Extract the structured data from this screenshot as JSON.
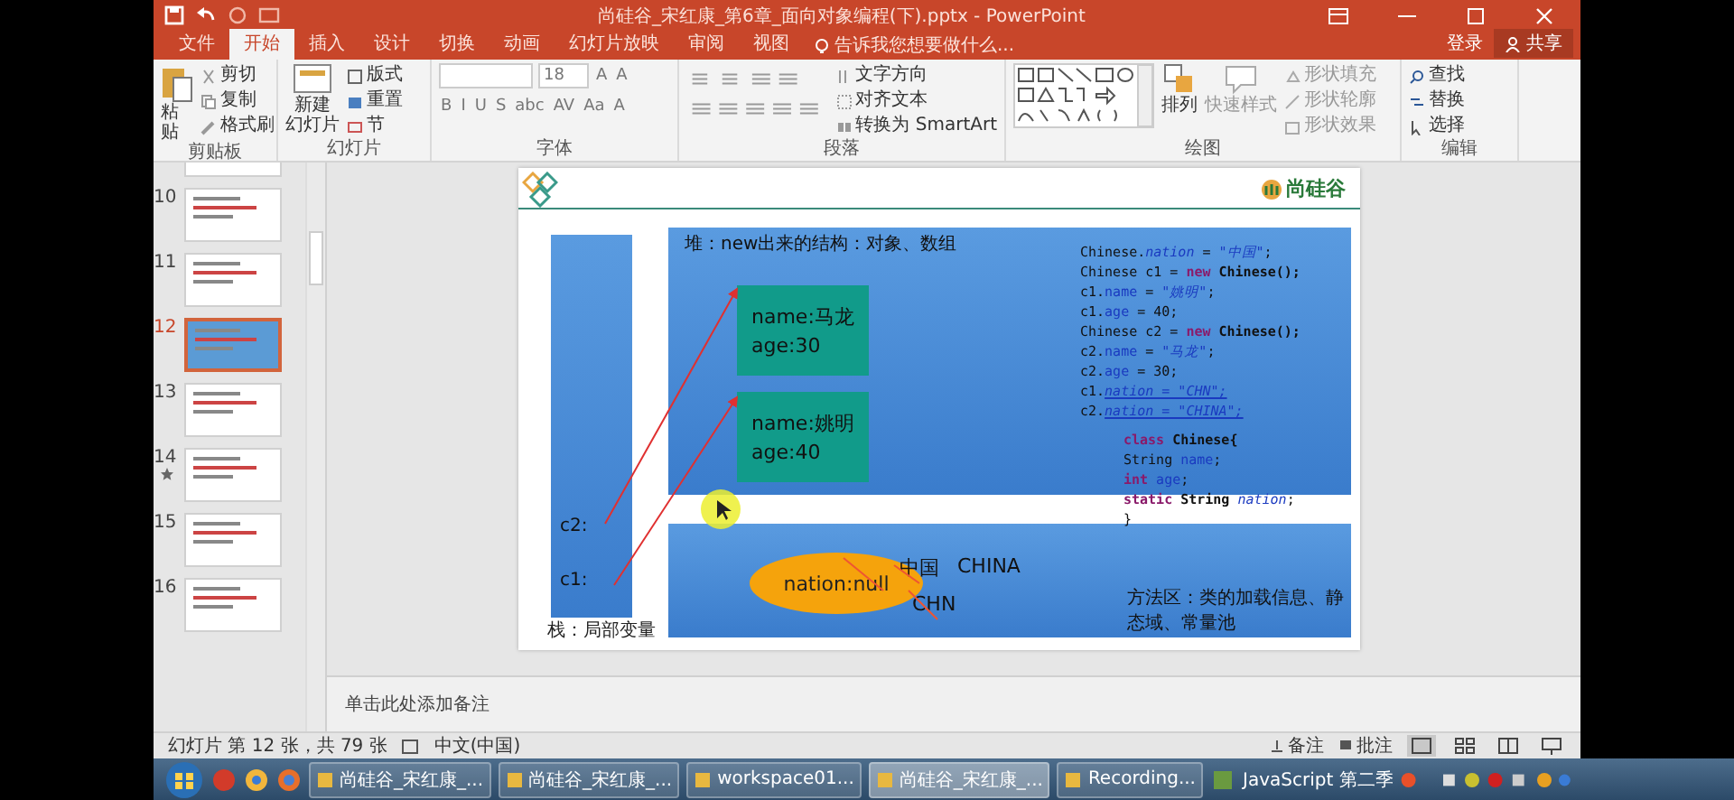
{
  "window": {
    "title": "尚硅谷_宋红康_第6章_面向对象编程(下).pptx - PowerPoint"
  },
  "tabs": [
    {
      "label": "文件",
      "selected": false
    },
    {
      "label": "开始",
      "selected": true
    },
    {
      "label": "插入",
      "selected": false
    },
    {
      "label": "设计",
      "selected": false
    },
    {
      "label": "切换",
      "selected": false
    },
    {
      "label": "动画",
      "selected": false
    },
    {
      "label": "幻灯片放映",
      "selected": false
    },
    {
      "label": "审阅",
      "selected": false
    },
    {
      "label": "视图",
      "selected": false
    }
  ],
  "tell_me": {
    "placeholder": "告诉我您想要做什么..."
  },
  "account": {
    "sign_in": "登录",
    "share": "共享"
  },
  "ribbon": {
    "clipboard": {
      "label": "剪贴板",
      "paste": "粘贴",
      "cut": "剪切",
      "copy": "复制",
      "painter": "格式刷"
    },
    "slides": {
      "label": "幻灯片",
      "new_slide": "新建",
      "new_slide_2": "幻灯片",
      "layout": "版式",
      "reset": "重置",
      "section": "节"
    },
    "font": {
      "label": "字体",
      "size": "18",
      "top_buttons": [
        "A",
        "A"
      ],
      "buttons": [
        "B",
        "I",
        "U",
        "S",
        "abc",
        "AV",
        "Aa",
        "A"
      ]
    },
    "paragraph": {
      "label": "段落",
      "direction": "文字方向",
      "align": "对齐文本",
      "smartart": "转换为 SmartArt"
    },
    "drawing": {
      "label": "绘图",
      "arrange": "排列",
      "quick_styles": "快速样式",
      "fill": "形状填充",
      "outline": "形状轮廓",
      "effects": "形状效果"
    },
    "editing": {
      "label": "编辑",
      "find": "查找",
      "replace": "替换",
      "select": "选择"
    }
  },
  "thumbnails": [
    {
      "number": "10",
      "selected": false,
      "starred": false
    },
    {
      "number": "11",
      "selected": false,
      "starred": false
    },
    {
      "number": "12",
      "selected": true,
      "starred": false
    },
    {
      "number": "13",
      "selected": false,
      "starred": false
    },
    {
      "number": "14",
      "selected": false,
      "starred": true
    },
    {
      "number": "15",
      "selected": false,
      "starred": false
    },
    {
      "number": "16",
      "selected": false,
      "starred": false
    }
  ],
  "slide": {
    "logo_text": "尚硅谷",
    "stack": {
      "label": "栈：局部变量",
      "vars": [
        "c2:",
        "c1:"
      ]
    },
    "heap": {
      "label": "堆：new出来的结构：对象、数组",
      "objects": [
        {
          "name": "name:马龙",
          "age": "age:30"
        },
        {
          "name": "name:姚明",
          "age": "age:40"
        }
      ]
    },
    "code": [
      [
        {
          "t": "Chinese.",
          "kind": "plain"
        },
        {
          "t": "nation",
          "kind": "field"
        },
        {
          "t": " = ",
          "kind": "plain"
        },
        {
          "t": "\"中国\"",
          "kind": "str"
        },
        {
          "t": ";",
          "kind": "plain"
        }
      ],
      [
        {
          "t": "Chinese c1 = ",
          "kind": "plain"
        },
        {
          "t": "new",
          "kind": "kw"
        },
        {
          "t": " Chinese();",
          "kind": "bold"
        }
      ],
      [
        {
          "t": "c1.",
          "kind": "plain"
        },
        {
          "t": "name",
          "kind": "name"
        },
        {
          "t": " = ",
          "kind": "plain"
        },
        {
          "t": "\"姚明\"",
          "kind": "str"
        },
        {
          "t": ";",
          "kind": "plain"
        }
      ],
      [
        {
          "t": "c1.",
          "kind": "plain"
        },
        {
          "t": "age",
          "kind": "name"
        },
        {
          "t": " = 40;",
          "kind": "plain"
        }
      ],
      [
        {
          "t": "Chinese c2 = ",
          "kind": "plain"
        },
        {
          "t": "new",
          "kind": "kw"
        },
        {
          "t": " Chinese();",
          "kind": "bold"
        }
      ],
      [
        {
          "t": "c2.",
          "kind": "plain"
        },
        {
          "t": "name",
          "kind": "name"
        },
        {
          "t": " = ",
          "kind": "plain"
        },
        {
          "t": "\"马龙\"",
          "kind": "str"
        },
        {
          "t": ";",
          "kind": "plain"
        }
      ],
      [
        {
          "t": "c2.",
          "kind": "plain"
        },
        {
          "t": "age",
          "kind": "name"
        },
        {
          "t": " = 30;",
          "kind": "plain"
        }
      ],
      [
        {
          "t": "c1.",
          "kind": "plain"
        },
        {
          "t": "nation = \"CHN\";",
          "kind": "link"
        }
      ],
      [
        {
          "t": "c2.",
          "kind": "plain"
        },
        {
          "t": "nation = \"CHINA\";",
          "kind": "link"
        }
      ]
    ],
    "class_code": [
      [
        {
          "t": "class",
          "kind": "kw"
        },
        {
          "t": " Chinese{",
          "kind": "bold"
        }
      ],
      [
        {
          "t": "String ",
          "kind": "plain"
        },
        {
          "t": "name",
          "kind": "name"
        },
        {
          "t": ";",
          "kind": "plain"
        }
      ],
      [
        {
          "t": "int",
          "kind": "kw"
        },
        {
          "t": " age",
          "kind": "name"
        },
        {
          "t": ";",
          "kind": "plain"
        }
      ],
      [
        {
          "t": "static",
          "kind": "kw"
        },
        {
          "t": " String ",
          "kind": "bold"
        },
        {
          "t": "nation",
          "kind": "field"
        },
        {
          "t": ";",
          "kind": "plain"
        }
      ],
      [
        {
          "t": "}",
          "kind": "plain"
        }
      ]
    ],
    "method_area": {
      "label": "方法区：类的加载信息、静态域、常量池",
      "static_field": "nation:null",
      "values": [
        "中国",
        "CHINA",
        "CHN"
      ]
    }
  },
  "notes": {
    "placeholder": "单击此处添加备注"
  },
  "status_bar": {
    "slide_info": "幻灯片 第 12 张，共 79 张",
    "language": "中文(中国)",
    "notes": "备注",
    "comments": "批注"
  },
  "taskbar": {
    "windows": [
      {
        "label": "尚硅谷_宋红康_...",
        "selected": false
      },
      {
        "label": "尚硅谷_宋红康_...",
        "selected": false
      },
      {
        "label": "workspace01...",
        "selected": false
      },
      {
        "label": "尚硅谷_宋红康_...",
        "selected": true
      },
      {
        "label": "Recording...",
        "selected": false
      }
    ],
    "tray_app": "JavaScript 第二季"
  }
}
